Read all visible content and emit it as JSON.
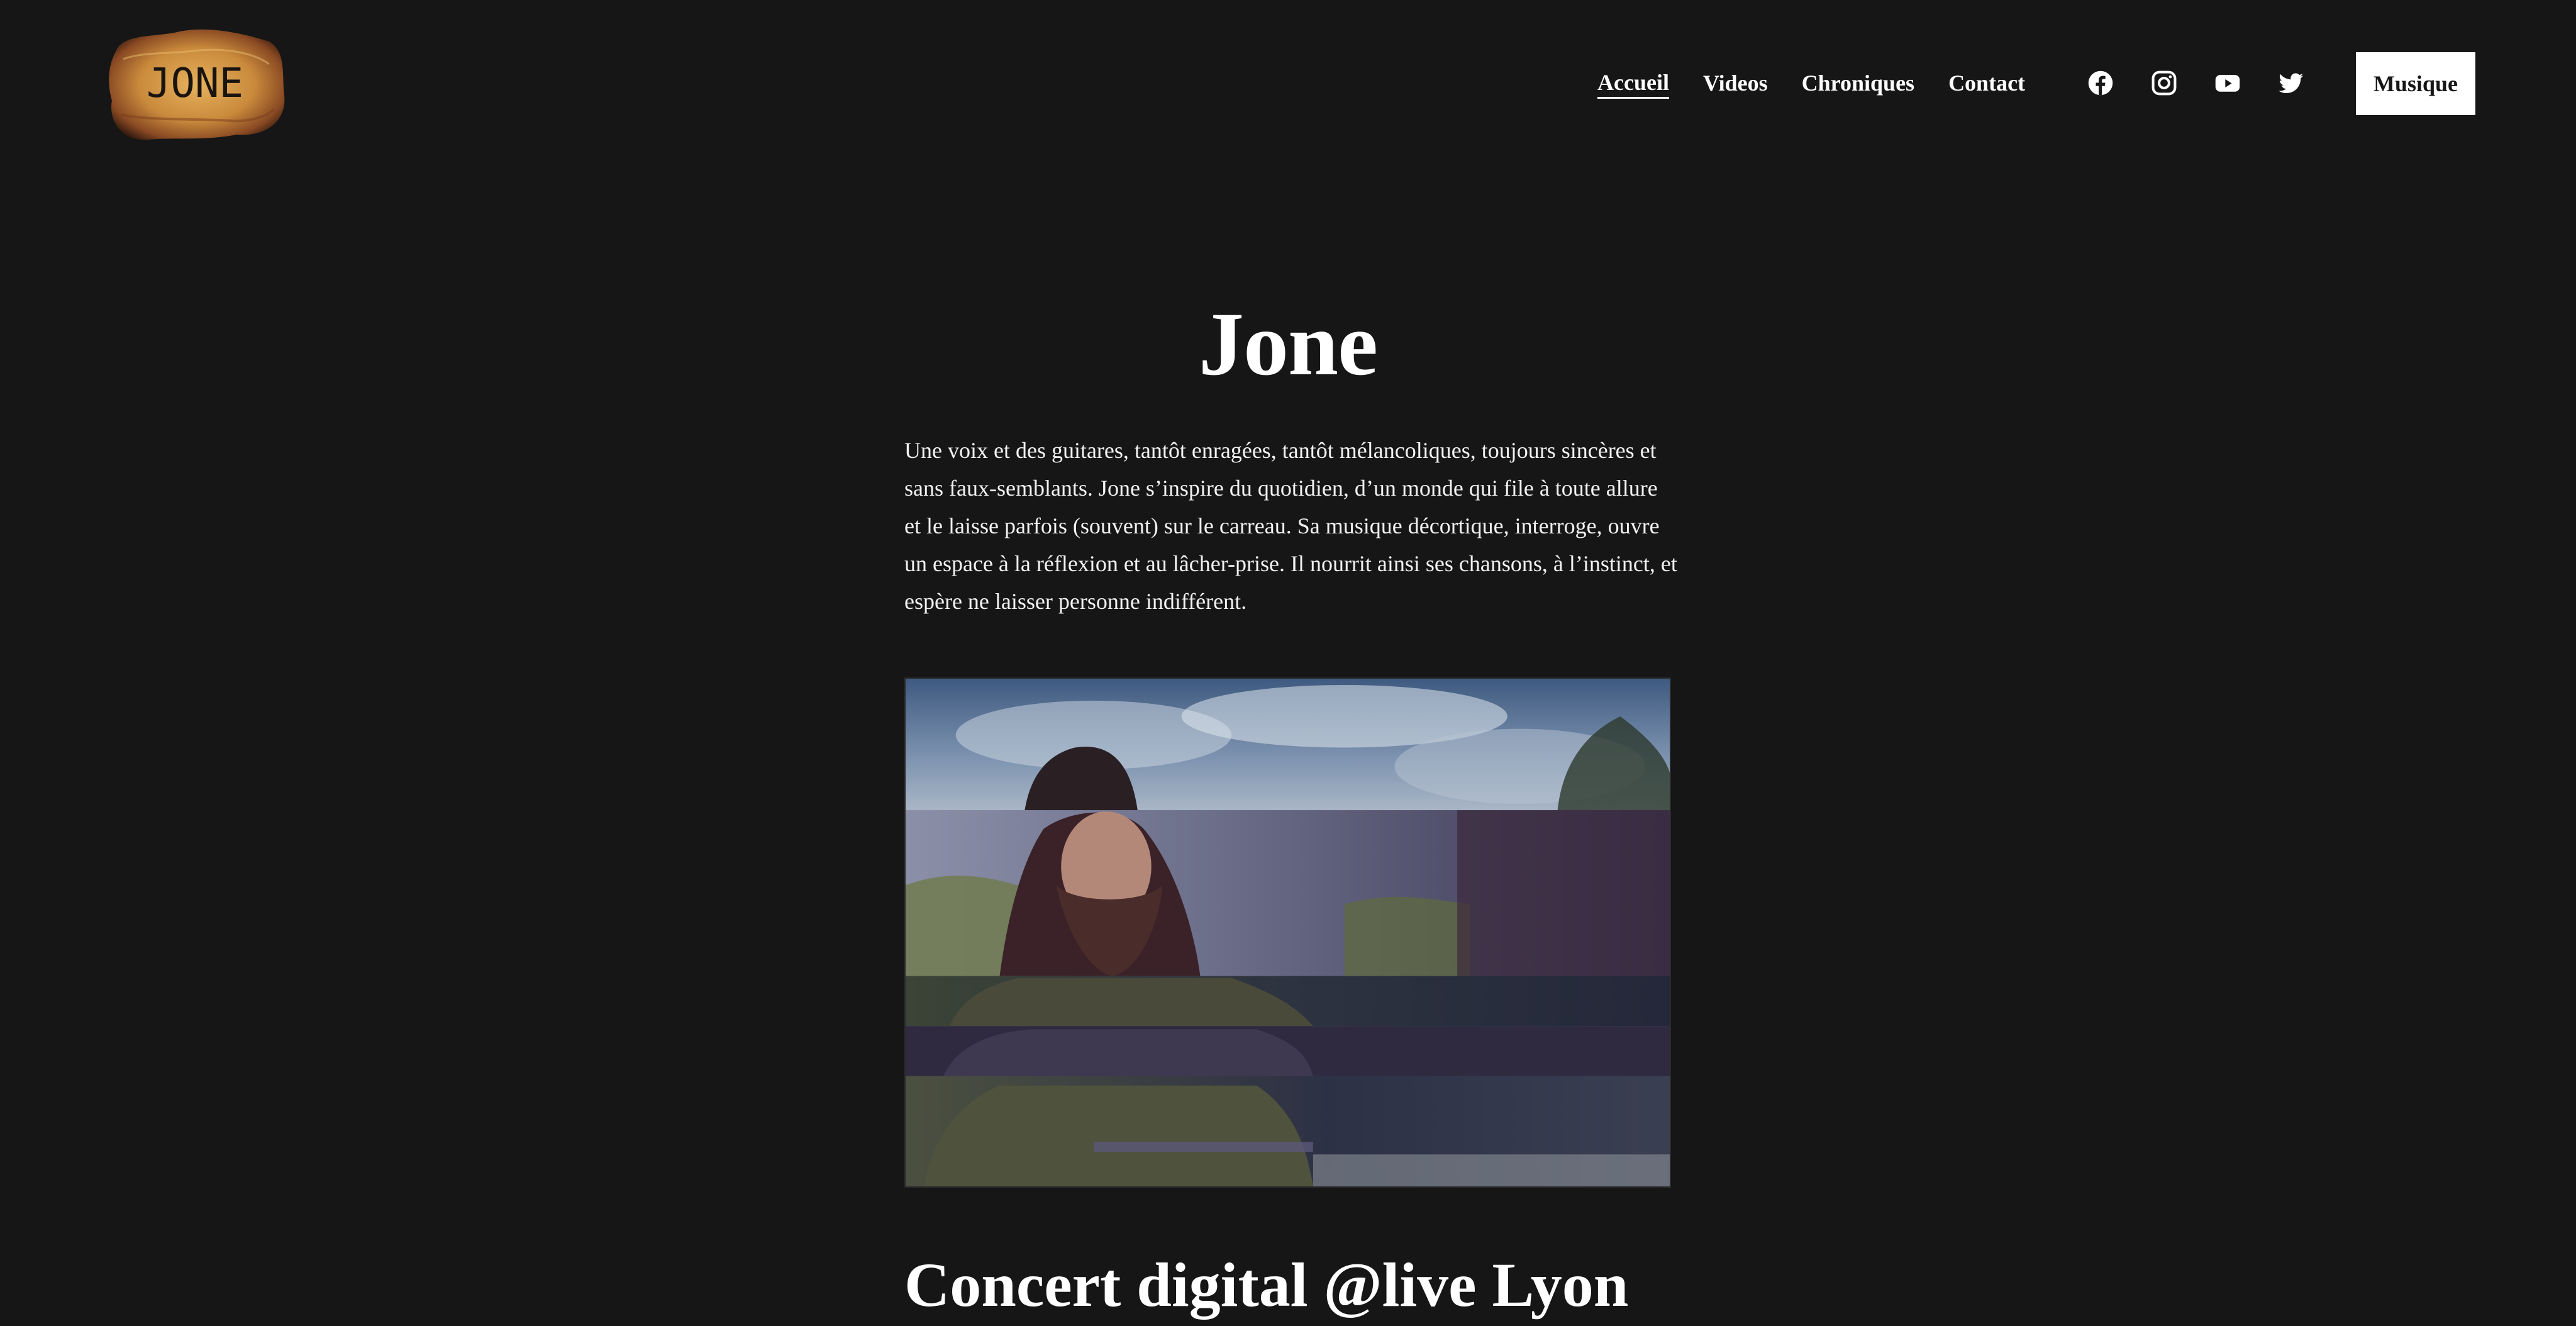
{
  "site": {
    "logo_text": "JONE"
  },
  "nav": {
    "items": [
      {
        "label": "Accueil",
        "current": true
      },
      {
        "label": "Videos",
        "current": false
      },
      {
        "label": "Chroniques",
        "current": false
      },
      {
        "label": "Contact",
        "current": false
      }
    ],
    "social": [
      {
        "icon": "facebook-icon"
      },
      {
        "icon": "instagram-icon"
      },
      {
        "icon": "youtube-icon"
      },
      {
        "icon": "twitter-icon"
      }
    ],
    "cta_label": "Musique"
  },
  "main": {
    "title": "Jone",
    "intro": "Une voix et des guitares, tantôt enragées, tantôt mélancoliques, toujours sincères et sans faux-semblants. Jone s’inspire du quotidien, d’un monde qui file à toute allure et le laisse parfois (souvent) sur le carreau. Sa musique décortique, interroge, ouvre un espace à la réflexion et au lâcher-prise. Il nourrit ainsi ses chansons, à l’instinct, et espère ne laisser personne indifférent.",
    "section_title": "Concert digital @live Lyon"
  },
  "colors": {
    "background": "#161616",
    "text": "#ffffff",
    "button_bg": "#ffffff",
    "button_text": "#161616",
    "logo_paper": "#c98a3c"
  }
}
